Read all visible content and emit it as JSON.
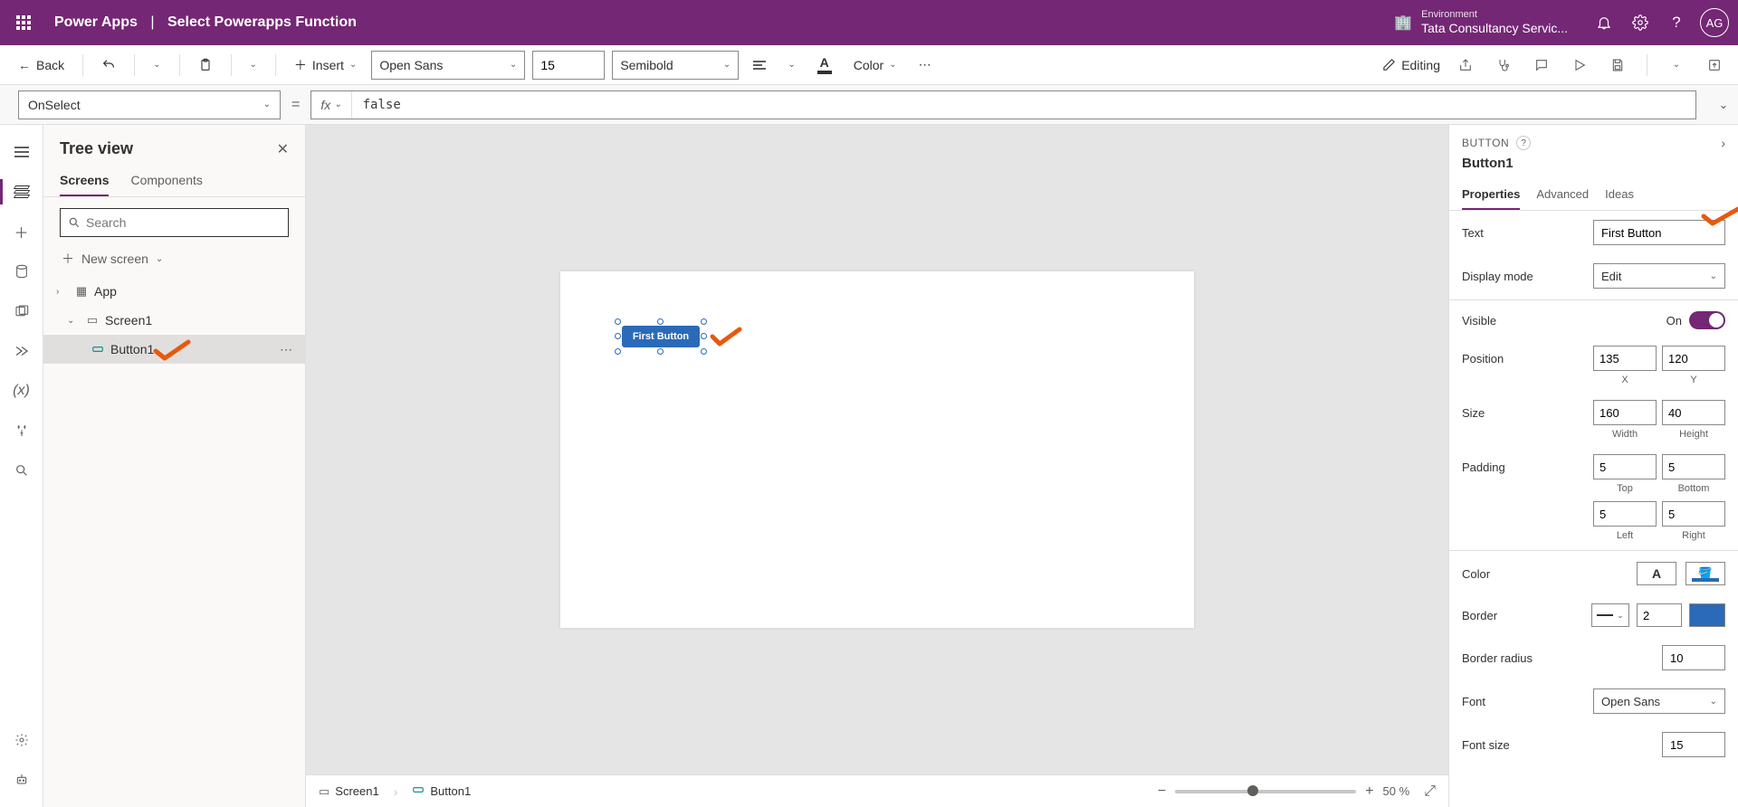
{
  "header": {
    "app_name": "Power Apps",
    "page_title": "Select Powerapps Function",
    "env_label": "Environment",
    "env_name": "Tata Consultancy Servic...",
    "avatar": "AG"
  },
  "cmdbar": {
    "back": "Back",
    "insert": "Insert",
    "font_family": "Open Sans",
    "font_size": "15",
    "font_weight": "Semibold",
    "color_label": "Color",
    "editing": "Editing"
  },
  "formula": {
    "property": "OnSelect",
    "fx": "fx",
    "expression": "false"
  },
  "tree": {
    "title": "Tree view",
    "tabs": {
      "screens": "Screens",
      "components": "Components"
    },
    "search_placeholder": "Search",
    "new_screen": "New screen",
    "items": {
      "app": "App",
      "screen1": "Screen1",
      "button1": "Button1"
    }
  },
  "canvas": {
    "button_text": "First Button",
    "breadcrumb": {
      "screen": "Screen1",
      "control": "Button1"
    },
    "zoom": "50",
    "zoom_unit": "%"
  },
  "props": {
    "type": "BUTTON",
    "name": "Button1",
    "tabs": {
      "properties": "Properties",
      "advanced": "Advanced",
      "ideas": "Ideas"
    },
    "text_label": "Text",
    "text_value": "First Button",
    "display_mode_label": "Display mode",
    "display_mode_value": "Edit",
    "visible_label": "Visible",
    "visible_value": "On",
    "position_label": "Position",
    "position_x": "135",
    "position_y": "120",
    "x_label": "X",
    "y_label": "Y",
    "size_label": "Size",
    "size_w": "160",
    "size_h": "40",
    "w_label": "Width",
    "h_label": "Height",
    "padding_label": "Padding",
    "pad_top": "5",
    "pad_bottom": "5",
    "pad_left": "5",
    "pad_right": "5",
    "top_label": "Top",
    "bottom_label": "Bottom",
    "left_label": "Left",
    "right_label": "Right",
    "color_label": "Color",
    "border_label": "Border",
    "border_width": "2",
    "border_radius_label": "Border radius",
    "border_radius": "10",
    "font_label": "Font",
    "font_value": "Open Sans",
    "font_size_label": "Font size",
    "font_size_value": "15"
  }
}
